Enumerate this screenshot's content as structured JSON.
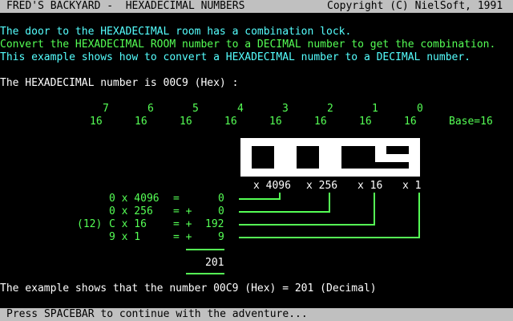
{
  "header": {
    "title": "FRED'S BACKYARD -  HEXADECIMAL NUMBERS",
    "copyright": "Copyright (C) NielSoft, 1991"
  },
  "intro": {
    "line1": "The door to the HEXADECIMAL room has a combination lock.",
    "line2": "Convert the HEXADECIMAL ROOM number to a DECIMAL number to get the combination.",
    "line3": "This example shows how to convert a HEXADECIMAL number to a DECIMAL number."
  },
  "prompt": "The HEXADECIMAL number is 00C9 (Hex) :",
  "exponents": [
    "7",
    "6",
    "5",
    "4",
    "3",
    "2",
    "1",
    "0"
  ],
  "bases": [
    "16",
    "16",
    "16",
    "16",
    "16",
    "16",
    "16",
    "16"
  ],
  "base_label": "Base=16",
  "digits": [
    "0",
    "0",
    "C",
    "9"
  ],
  "multipliers": [
    "x 4096",
    "x 256",
    "x 16",
    "x 1"
  ],
  "calc_rows": [
    {
      "prefix": "",
      "expr": "0 x 4096",
      "eq": "=",
      "val": "0"
    },
    {
      "prefix": "",
      "expr": "0 x 256",
      "eq": "= +",
      "val": "0"
    },
    {
      "prefix": "(12)",
      "expr": "C x 16",
      "eq": "= +",
      "val": "192"
    },
    {
      "prefix": "",
      "expr": "9 x 1",
      "eq": "= +",
      "val": "9"
    }
  ],
  "total": "201",
  "conclusion": "The example shows that the number 00C9 (Hex) = 201 (Decimal)",
  "footer": "Press SPACEBAR to continue with the adventure...",
  "colors": {
    "background": "#000000",
    "cyan": "#55ffff",
    "green": "#55ff55",
    "white": "#ffffff",
    "bar": "#c0c0c0"
  }
}
